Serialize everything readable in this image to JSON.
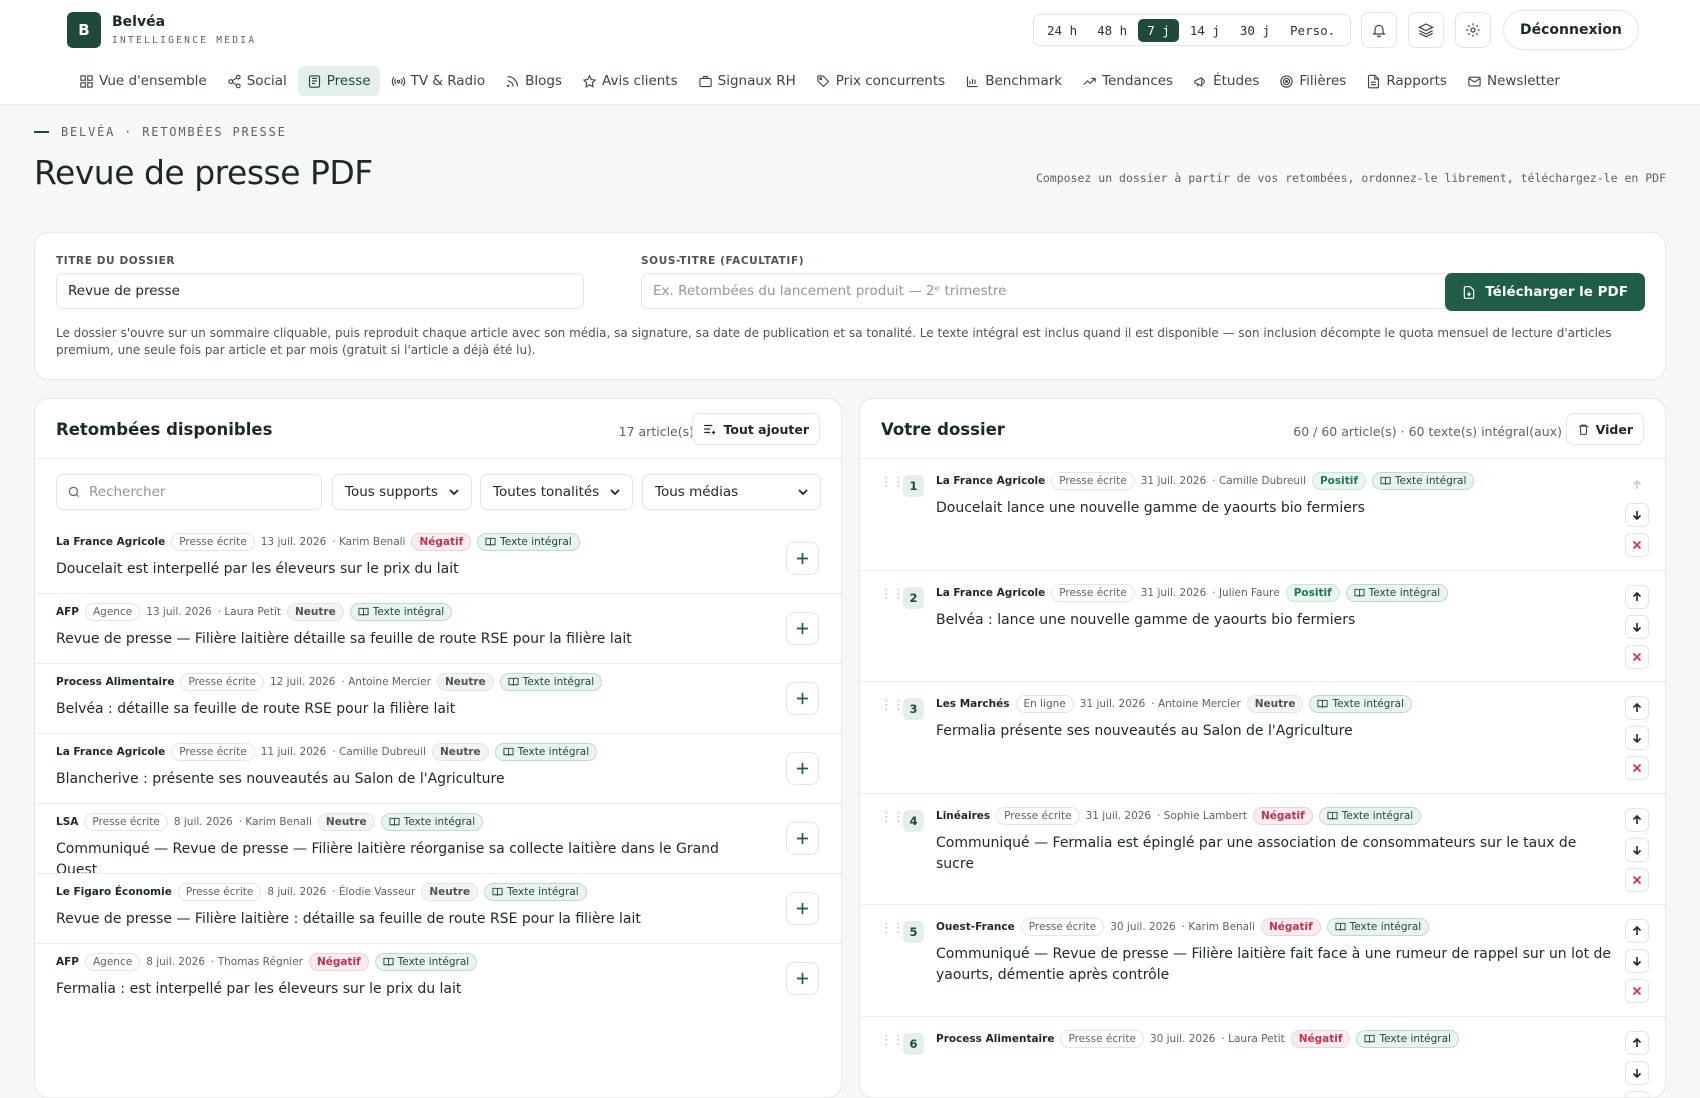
{
  "brand": {
    "logo_letter": "B",
    "name": "Belvéa",
    "tagline": "INTELLIGENCE MEDIA"
  },
  "periods": [
    "24 h",
    "48 h",
    "7 j",
    "14 j",
    "30 j",
    "Perso."
  ],
  "active_period": "7 j",
  "header": {
    "logout_label": "Déconnexion"
  },
  "nav": [
    {
      "label": "Vue d'ensemble",
      "icon": "grid-icon"
    },
    {
      "label": "Social",
      "icon": "share-icon"
    },
    {
      "label": "Presse",
      "icon": "newspaper-icon",
      "active": true
    },
    {
      "label": "TV & Radio",
      "icon": "broadcast-icon"
    },
    {
      "label": "Blogs",
      "icon": "rss-icon"
    },
    {
      "label": "Avis clients",
      "icon": "star-icon"
    },
    {
      "label": "Signaux RH",
      "icon": "briefcase-icon"
    },
    {
      "label": "Prix concurrents",
      "icon": "tag-icon"
    },
    {
      "label": "Benchmark",
      "icon": "bar-chart-icon"
    },
    {
      "label": "Tendances",
      "icon": "trend-icon"
    },
    {
      "label": "Études",
      "icon": "megaphone-icon"
    },
    {
      "label": "Filières",
      "icon": "target-icon"
    },
    {
      "label": "Rapports",
      "icon": "file-icon"
    },
    {
      "label": "Newsletter",
      "icon": "mail-icon"
    }
  ],
  "page": {
    "kicker": "BELVÉA · RETOMBÉES PRESSE",
    "title": "Revue de presse PDF",
    "description": "Composez un dossier à partir de vos retombées, ordonnez-le librement, téléchargez-le en PDF"
  },
  "form": {
    "title_label": "TITRE DU DOSSIER",
    "title_value": "Revue de presse",
    "subtitle_label": "SOUS-TITRE (FACULTATIF)",
    "subtitle_placeholder": "Ex. Retombées du lancement produit — 2ᵉ trimestre",
    "download_label": "Télécharger le PDF",
    "note": "Le dossier s'ouvre sur un sommaire cliquable, puis reproduit chaque article avec son média, sa signature, sa date de publication et sa tonalité. Le texte intégral est inclus quand il est disponible — son inclusion décompte le quota mensuel de lecture d'articles premium, une seule fois par article et par mois (gratuit si l'article a déjà été lu)."
  },
  "available": {
    "title": "Retombées disponibles",
    "count": "17 article(s)",
    "add_all_label": "Tout ajouter",
    "search_placeholder": "Rechercher",
    "filter_supports": "Tous supports",
    "filter_tones": "Toutes tonalités",
    "filter_media": "Tous médias",
    "articles": [
      {
        "media": "La France Agricole",
        "support": "Presse écrite",
        "date": "13 juil. 2026",
        "author": "· Karim Benali",
        "tone": "Négatif",
        "tone_class": "neg",
        "full": "Texte intégral",
        "headline": "Doucelait est interpellé par les éleveurs sur le prix du lait"
      },
      {
        "media": "AFP",
        "support": "Agence",
        "date": "13 juil. 2026",
        "author": "· Laura Petit",
        "tone": "Neutre",
        "tone_class": "neu",
        "full": "Texte intégral",
        "headline": "Revue de presse — Filière laitière détaille sa feuille de route RSE pour la filière lait"
      },
      {
        "media": "Process Alimentaire",
        "support": "Presse écrite",
        "date": "12 juil. 2026",
        "author": "· Antoine Mercier",
        "tone": "Neutre",
        "tone_class": "neu",
        "full": "Texte intégral",
        "headline": "Belvéa : détaille sa feuille de route RSE pour la filière lait"
      },
      {
        "media": "La France Agricole",
        "support": "Presse écrite",
        "date": "11 juil. 2026",
        "author": "· Camille Dubreuil",
        "tone": "Neutre",
        "tone_class": "neu",
        "full": "Texte intégral",
        "headline": "Blancherive : présente ses nouveautés au Salon de l'Agriculture"
      },
      {
        "media": "LSA",
        "support": "Presse écrite",
        "date": "8 juil. 2026",
        "author": "· Karim Benali",
        "tone": "Neutre",
        "tone_class": "neu",
        "full": "Texte intégral",
        "headline": "Communiqué — Revue de presse — Filière laitière réorganise sa collecte laitière dans le Grand Ouest"
      },
      {
        "media": "Le Figaro Économie",
        "support": "Presse écrite",
        "date": "8 juil. 2026",
        "author": "· Élodie Vasseur",
        "tone": "Neutre",
        "tone_class": "neu",
        "full": "Texte intégral",
        "headline": "Revue de presse — Filière laitière : détaille sa feuille de route RSE pour la filière lait"
      },
      {
        "media": "AFP",
        "support": "Agence",
        "date": "8 juil. 2026",
        "author": "· Thomas Régnier",
        "tone": "Négatif",
        "tone_class": "neg",
        "full": "Texte intégral",
        "headline": "Fermalia : est interpellé par les éleveurs sur le prix du lait"
      }
    ]
  },
  "dossier": {
    "title": "Votre dossier",
    "count": "60 / 60 article(s) · 60 texte(s) intégral(aux)",
    "clear_label": "Vider",
    "items": [
      {
        "num": "1",
        "media": "La France Agricole",
        "support": "Presse écrite",
        "date": "31 juil. 2026",
        "author": "· Camille Dubreuil",
        "tone": "Positif",
        "tone_class": "pos",
        "full": "Texte intégral",
        "headline": "Doucelait lance une nouvelle gamme de yaourts bio fermiers"
      },
      {
        "num": "2",
        "media": "La France Agricole",
        "support": "Presse écrite",
        "date": "31 juil. 2026",
        "author": "· Julien Faure",
        "tone": "Positif",
        "tone_class": "pos",
        "full": "Texte intégral",
        "headline": "Belvéa : lance une nouvelle gamme de yaourts bio fermiers"
      },
      {
        "num": "3",
        "media": "Les Marchés",
        "support": "En ligne",
        "date": "31 juil. 2026",
        "author": "· Antoine Mercier",
        "tone": "Neutre",
        "tone_class": "neu",
        "full": "Texte intégral",
        "headline": "Fermalia présente ses nouveautés au Salon de l'Agriculture"
      },
      {
        "num": "4",
        "media": "Linéaires",
        "support": "Presse écrite",
        "date": "31 juil. 2026",
        "author": "· Sophie Lambert",
        "tone": "Négatif",
        "tone_class": "neg",
        "full": "Texte intégral",
        "headline": "Communiqué — Fermalia est épinglé par une association de consommateurs sur le taux de sucre"
      },
      {
        "num": "5",
        "media": "Ouest-France",
        "support": "Presse écrite",
        "date": "30 juil. 2026",
        "author": "· Karim Benali",
        "tone": "Négatif",
        "tone_class": "neg",
        "full": "Texte intégral",
        "headline": "Communiqué — Revue de presse — Filière laitière fait face à une rumeur de rappel sur un lot de yaourts, démentie après contrôle"
      },
      {
        "num": "6",
        "media": "Process Alimentaire",
        "support": "Presse écrite",
        "date": "30 juil. 2026",
        "author": "· Laura Petit",
        "tone": "Négatif",
        "tone_class": "neg",
        "full": "Texte intégral",
        "headline": ""
      }
    ]
  },
  "colors": {
    "brand": "#1f4a3b",
    "accent_button": "#1f5e45",
    "negative": "#c0344d",
    "positive": "#1f7a4f"
  }
}
